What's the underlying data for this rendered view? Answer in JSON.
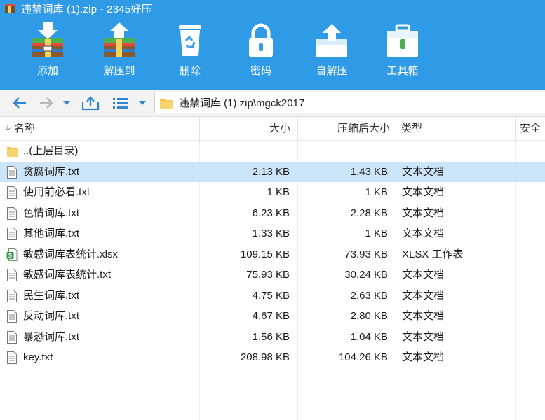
{
  "window": {
    "title": "违禁词库 (1).zip - 2345好压"
  },
  "toolbar": {
    "items": [
      {
        "label": "添加",
        "icon": "add-archive-icon"
      },
      {
        "label": "解压到",
        "icon": "extract-to-icon"
      },
      {
        "label": "删除",
        "icon": "recycle-bin-icon"
      },
      {
        "label": "密码",
        "icon": "lock-icon"
      },
      {
        "label": "自解压",
        "icon": "self-extract-icon"
      },
      {
        "label": "工具箱",
        "icon": "toolbox-icon"
      }
    ]
  },
  "address": {
    "path": "违禁词库 (1).zip\\mgck2017"
  },
  "columns": {
    "name": "名称",
    "size": "大小",
    "compressed": "压缩后大小",
    "type": "类型",
    "security": "安全"
  },
  "files": [
    {
      "name": "..(上层目录)",
      "size": "",
      "compressed": "",
      "type": "",
      "icon": "folder-icon",
      "selected": false
    },
    {
      "name": "贪腐词库.txt",
      "size": "2.13 KB",
      "compressed": "1.43 KB",
      "type": "文本文档",
      "icon": "text-file-icon",
      "selected": true
    },
    {
      "name": "使用前必看.txt",
      "size": "1 KB",
      "compressed": "1 KB",
      "type": "文本文档",
      "icon": "text-file-icon",
      "selected": false
    },
    {
      "name": "色情词库.txt",
      "size": "6.23 KB",
      "compressed": "2.28 KB",
      "type": "文本文档",
      "icon": "text-file-icon",
      "selected": false
    },
    {
      "name": "其他词库.txt",
      "size": "1.33 KB",
      "compressed": "1 KB",
      "type": "文本文档",
      "icon": "text-file-icon",
      "selected": false
    },
    {
      "name": "敏感词库表统计.xlsx",
      "size": "109.15 KB",
      "compressed": "73.93 KB",
      "type": "XLSX 工作表",
      "icon": "spreadsheet-file-icon",
      "selected": false
    },
    {
      "name": "敏感词库表统计.txt",
      "size": "75.93 KB",
      "compressed": "30.24 KB",
      "type": "文本文档",
      "icon": "text-file-icon",
      "selected": false
    },
    {
      "name": "民生词库.txt",
      "size": "4.75 KB",
      "compressed": "2.63 KB",
      "type": "文本文档",
      "icon": "text-file-icon",
      "selected": false
    },
    {
      "name": "反动词库.txt",
      "size": "4.67 KB",
      "compressed": "2.80 KB",
      "type": "文本文档",
      "icon": "text-file-icon",
      "selected": false
    },
    {
      "name": "暴恐词库.txt",
      "size": "1.56 KB",
      "compressed": "1.04 KB",
      "type": "文本文档",
      "icon": "text-file-icon",
      "selected": false
    },
    {
      "name": "key.txt",
      "size": "208.98 KB",
      "compressed": "104.26 KB",
      "type": "文本文档",
      "icon": "text-file-icon",
      "selected": false
    }
  ],
  "colors": {
    "toolbar_bg": "#2f9ae5",
    "selection": "#cce4f7",
    "nav_arrow": "#2f86d6"
  }
}
